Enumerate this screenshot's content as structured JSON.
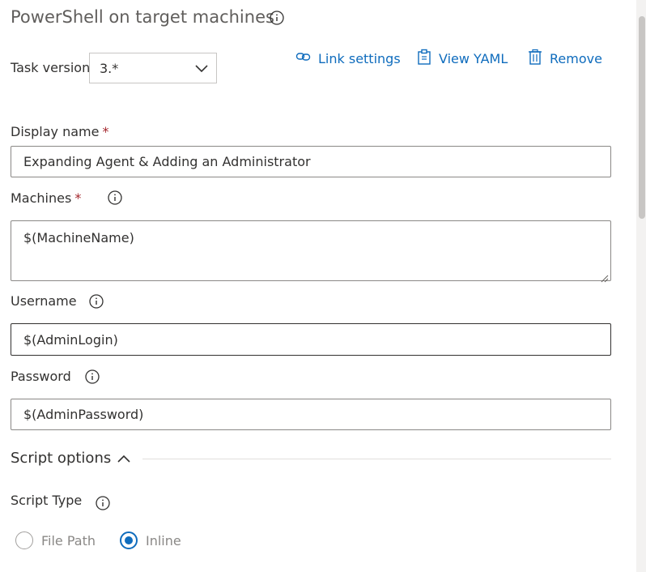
{
  "header": {
    "title": "PowerShell on target machines"
  },
  "task_version": {
    "label": "Task version",
    "value": "3.*"
  },
  "toolbar": {
    "link_settings": "Link settings",
    "view_yaml": "View YAML",
    "remove": "Remove"
  },
  "fields": {
    "display_name": {
      "label": "Display name",
      "required": "*",
      "value": "Expanding Agent & Adding an Administrator"
    },
    "machines": {
      "label": "Machines",
      "required": "*",
      "value": "$(MachineName)"
    },
    "username": {
      "label": "Username",
      "value": "$(AdminLogin)"
    },
    "password": {
      "label": "Password",
      "value": "$(AdminPassword)"
    }
  },
  "script_options": {
    "title": "Script options",
    "script_type": {
      "label": "Script Type",
      "options": [
        "File Path",
        "Inline"
      ],
      "selected": "Inline"
    }
  },
  "colors": {
    "accent": "#0f6cbd",
    "required": "#a4262c",
    "border": "#8a8886"
  },
  "icons": [
    "info-icon",
    "link-icon",
    "clipboard-icon",
    "trash-icon",
    "chevron-down-icon",
    "chevron-up-icon"
  ]
}
